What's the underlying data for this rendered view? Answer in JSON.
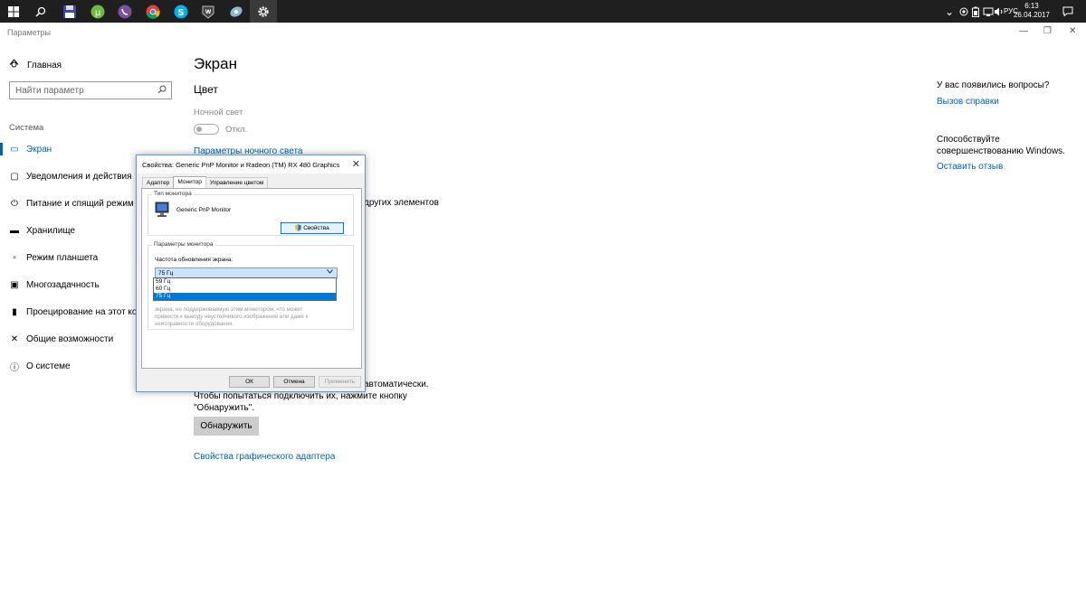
{
  "taskbar": {
    "icons": [
      "windows-start-icon",
      "search-icon",
      "save-floppy-icon",
      "utorrent-icon",
      "viber-icon",
      "chrome-icon",
      "skype-icon",
      "game-icon",
      "pinned-app-icon",
      "settings-gear-icon"
    ],
    "tray": {
      "chevron": "⌄",
      "lang": "РУС",
      "time": "6:13",
      "date": "26.04.2017"
    }
  },
  "window": {
    "title": "Параметры",
    "minimize": "—",
    "maximize": "❐",
    "close": "✕"
  },
  "sidebar": {
    "home": "Главная",
    "search_placeholder": "Найти параметр",
    "section": "Система",
    "items": [
      {
        "label": "Экран",
        "icon": "monitor-icon",
        "glyph": "▭"
      },
      {
        "label": "Уведомления и действия",
        "icon": "notifications-icon",
        "glyph": "▢"
      },
      {
        "label": "Питание и спящий режим",
        "icon": "power-icon",
        "glyph": "⏻"
      },
      {
        "label": "Хранилище",
        "icon": "storage-icon",
        "glyph": "▬"
      },
      {
        "label": "Режим планшета",
        "icon": "tablet-mode-icon",
        "glyph": "▫"
      },
      {
        "label": "Многозадачность",
        "icon": "multitasking-icon",
        "glyph": "▣"
      },
      {
        "label": "Проецирование на этот компьютер",
        "icon": "projection-icon",
        "glyph": "▮"
      },
      {
        "label": "Общие возможности",
        "icon": "shared-experiences-icon",
        "glyph": "✕"
      },
      {
        "label": "О системе",
        "icon": "info-icon",
        "glyph": "ⓘ"
      }
    ]
  },
  "main": {
    "title": "Экран",
    "color_heading": "Цвет",
    "night_light_label": "Ночной свет",
    "night_light_state": "Откл.",
    "night_light_on": false,
    "night_light_settings_link": "Параметры ночного света",
    "partial_text": "других элементов",
    "detect_partial_text": "автоматически.",
    "detect_line2": "Чтобы попытаться подключить их, нажмите кнопку",
    "detect_line3": "\"Обнаружить\".",
    "detect_button": "Обнаружить",
    "adapter_link": "Свойства графического адаптера"
  },
  "right": {
    "questions": "У вас появились вопросы?",
    "help_link": "Вызов справки",
    "improve_line1": "Способствуйте",
    "improve_line2": "совершенствованию Windows.",
    "feedback_link": "Оставить отзыв"
  },
  "dialog": {
    "title": "Свойства: Generic PnP Monitor и Radeon (TM) RX 480 Graphics",
    "close": "✕",
    "tabs": [
      "Адаптер",
      "Монитор",
      "Управление цветом"
    ],
    "active_tab": 1,
    "monitor_type_label": "Тип монитора",
    "monitor_name": "Generic PnP Monitor",
    "properties_button": "Свойства",
    "monitor_settings_label": "Параметры монитора",
    "refresh_label": "Частота обновления экрана:",
    "refresh_selected": "75 Гц",
    "refresh_options": [
      "59 Гц",
      "60 Гц",
      "75 Гц"
    ],
    "refresh_highlighted": 2,
    "warning_line1": "экрана, не поддерживаемую этим монитором, что может",
    "warning_line2": "привести к выводу неустойчивого изображения или даже к",
    "warning_line3": "неисправности оборудования.",
    "ok": "ОК",
    "cancel": "Отмена",
    "apply": "Применить"
  }
}
